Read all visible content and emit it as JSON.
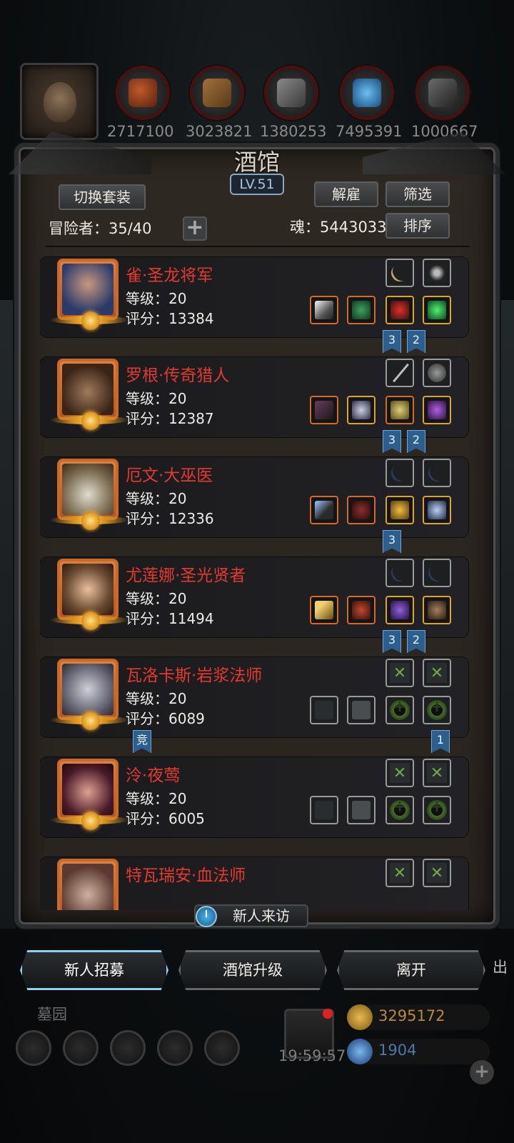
{
  "top_resources": {
    "numbers": [
      "2717100",
      "3023821",
      "1380253",
      "7495391",
      "1000667"
    ]
  },
  "tavern": {
    "title": "酒馆",
    "level": "LV.51",
    "switch_outfit": "切换套装",
    "dismiss": "解雇",
    "filter": "筛选",
    "sort": "排序",
    "adventurers_label": "冒险者：35/40",
    "soul_label": "魂：5443033"
  },
  "heroes": [
    {
      "name": "雀·圣龙将军",
      "level": "等级：20",
      "score": "评分：13384",
      "tags": [
        "3",
        "2"
      ]
    },
    {
      "name": "罗根·传奇猎人",
      "level": "等级：20",
      "score": "评分：12387",
      "tags": [
        "3",
        "2"
      ]
    },
    {
      "name": "厄文·大巫医",
      "level": "等级：20",
      "score": "评分：12336",
      "tags": [
        "3"
      ]
    },
    {
      "name": "尤莲娜·圣光贤者",
      "level": "等级：20",
      "score": "评分：11494",
      "tags": [
        "3",
        "2"
      ]
    },
    {
      "name": "瓦洛卡斯·岩浆法师",
      "level": "等级：20",
      "score": "评分：6089",
      "tags": [
        "竞",
        "1"
      ]
    },
    {
      "name": "泠·夜莺",
      "level": "等级：20",
      "score": "评分：6005",
      "tags": []
    },
    {
      "name": "特瓦瑞安·血法师",
      "level": "",
      "score": "",
      "tags": []
    }
  ],
  "new_visitor": "新人来访",
  "actions": {
    "recruit": "新人招募",
    "upgrade": "酒馆升级",
    "leave": "离开"
  },
  "bottom": {
    "tomb": "墓园",
    "timer": "19:59:57",
    "gold": "3295172",
    "gems": "1904",
    "side_text": "出"
  },
  "colors": {
    "hero_name": "#e23a30",
    "tag_blue": "#2c5f8e",
    "frame_orange": "#c96a2a",
    "gold_text": "#b88a3c",
    "gem_text": "#4a78b0"
  }
}
